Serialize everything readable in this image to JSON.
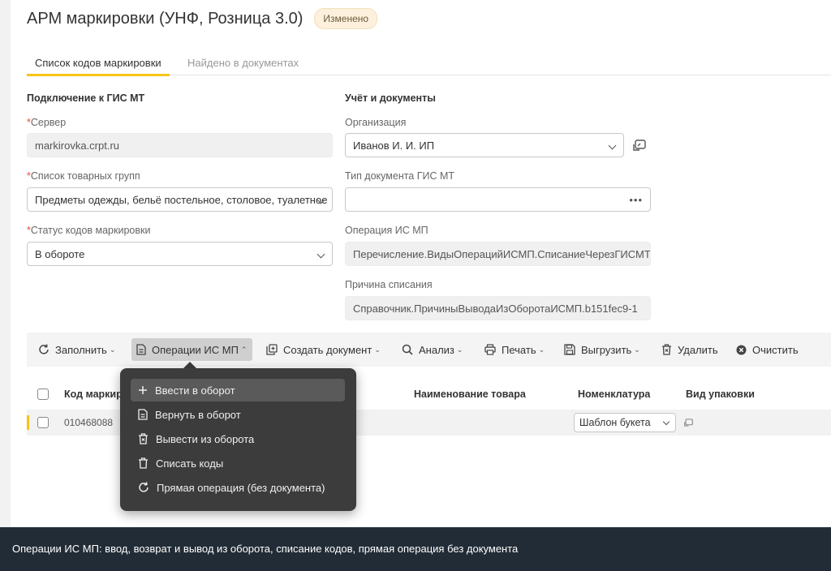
{
  "window": {
    "title": "АРМ маркировки (УНФ, Розница 3.0)",
    "badge": "Изменено"
  },
  "tabs": [
    {
      "label": "Список кодов маркировки"
    },
    {
      "label": "Найдено в документах"
    }
  ],
  "left_section": {
    "title": "Подключение к ГИС МТ",
    "server": {
      "label": "Сервер",
      "value": "markirovka.crpt.ru"
    },
    "groups": {
      "label": "Список товарных групп",
      "value": "Предметы одежды, бельё постельное, столовое, туалетное"
    },
    "status": {
      "label": "Статус кодов маркировки",
      "value": "В обороте"
    }
  },
  "right_section": {
    "title": "Учёт и документы",
    "org": {
      "label": "Организация",
      "value": "Иванов И. И. ИП"
    },
    "doc_type": {
      "label": "Тип документа ГИС МТ",
      "value": ""
    },
    "operation": {
      "label": "Операция ИС МП",
      "value": "Перечисление.ВидыОперацийИСМП.СписаниеЧерезГИСМТ"
    },
    "reason": {
      "label": "Причина списания",
      "value": "Справочник.ПричиныВыводаИзОборотаИСМП.b151fec9-1"
    }
  },
  "required_mark": "*",
  "toolbar": {
    "fill": "Заполнить",
    "ops": "Операции ИС МП",
    "create_doc": "Создать документ",
    "analysis": "Анализ",
    "print": "Печать",
    "export": "Выгрузить",
    "delete": "Удалить",
    "clear": "Очистить"
  },
  "table": {
    "headers": {
      "code": "Код маркир",
      "name": "Наименование товара",
      "nomenclature": "Номенклатура",
      "package": "Вид упаковки"
    },
    "rows": [
      {
        "code": "010468088",
        "nomenclature": "Шаблон букета"
      }
    ]
  },
  "menu": {
    "items": [
      {
        "label": "Ввести в оборот",
        "icon": "plus-icon"
      },
      {
        "label": "Вернуть в оборот",
        "icon": "document-icon"
      },
      {
        "label": "Вывести из оборота",
        "icon": "trash-x-icon"
      },
      {
        "label": "Списать коды",
        "icon": "trash-icon"
      },
      {
        "label": "Прямая операция (без документа)",
        "icon": "refresh-icon"
      }
    ]
  },
  "status_bar": {
    "text": "Операции ИС МП: ввод, возврат и вывод из оборота, списание кодов, прямая операция без документа"
  },
  "colors": {
    "accent": "#f5c518",
    "menu_bg": "#3c3c3c",
    "status_bg": "#222c36",
    "required": "#e74c3c"
  }
}
